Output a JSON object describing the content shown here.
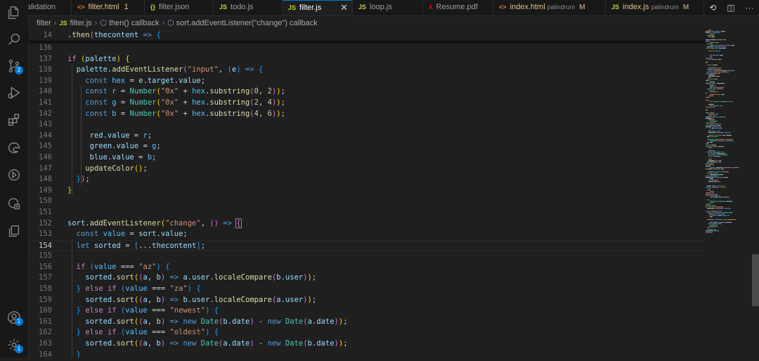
{
  "tabs": [
    {
      "label": "alidation",
      "icon": "",
      "desc": "",
      "flag": ""
    },
    {
      "label": "filter.html",
      "icon": "<>",
      "iconcls": "ic-html",
      "desc": "",
      "flag": "1",
      "flagcls": "err",
      "mod": true
    },
    {
      "label": "filter.json",
      "icon": "{}",
      "iconcls": "ic-json",
      "desc": "",
      "flag": ""
    },
    {
      "label": "todo.js",
      "icon": "JS",
      "iconcls": "ic-js",
      "desc": "",
      "flag": ""
    },
    {
      "label": "filter.js",
      "icon": "JS",
      "iconcls": "ic-js",
      "desc": "",
      "flag": "",
      "active": true
    },
    {
      "label": "loop.js",
      "icon": "JS",
      "iconcls": "ic-js",
      "desc": "",
      "flag": ""
    },
    {
      "label": "Resume.pdf",
      "icon": "⅄",
      "iconcls": "ic-pdf",
      "desc": "",
      "flag": ""
    },
    {
      "label": "index.html",
      "icon": "<>",
      "iconcls": "ic-html",
      "desc": "palindrum",
      "flag": "M",
      "mod": true
    },
    {
      "label": "index.js",
      "icon": "JS",
      "iconcls": "ic-js",
      "desc": "palindrum",
      "flag": "M",
      "mod": true
    }
  ],
  "tab_actions": {
    "history": "⟲",
    "split": "◫",
    "more": "···"
  },
  "breadcrumb": {
    "folder": "filter",
    "file_icon": "JS",
    "file": "filter.js",
    "scope1": "then() callback",
    "scope2": "sort.addEventListener(\"change\") callback"
  },
  "badges": {
    "source_control": "2",
    "accounts": "1",
    "manage": "1"
  },
  "activity_icons": [
    "explorer-icon",
    "search-icon",
    "source-control-icon",
    "run-debug-icon",
    "extensions-icon",
    "edge-icon",
    "github-actions-icon",
    "remote-explorer-icon",
    "copy-icon",
    "accounts-icon",
    "settings-gear-icon"
  ],
  "sticky_line": {
    "num": "14",
    "html": "  .<span class=\"fn\">then</span><span class=\"p2\">(</span><span class=\"var\">thecontent</span> <span class=\"kw\">=&gt;</span> <span class=\"p3\">{</span>"
  },
  "current_line": "154",
  "lines": [
    {
      "n": "136",
      "c": ""
    },
    {
      "n": "137",
      "c": "<span class=\"ctl\">if</span> <span class=\"p1\">(</span><span class=\"var\">palette</span><span class=\"p1\">)</span> <span class=\"p1\">{</span>"
    },
    {
      "n": "138",
      "c": "  <span class=\"var\">palette</span>.<span class=\"fn\">addEventListener</span><span class=\"p2\">(</span><span class=\"str\">\"input\"</span>, <span class=\"p3\">(</span><span class=\"var\">e</span><span class=\"p3\">)</span> <span class=\"kw\">=&gt;</span> <span class=\"p3\">{</span>"
    },
    {
      "n": "139",
      "c": "    <span class=\"kw\">const</span> <span class=\"cst\">hex</span> <span class=\"op\">=</span> <span class=\"var\">e</span>.<span class=\"var\">target</span>.<span class=\"var\">value</span>;"
    },
    {
      "n": "140",
      "c": "    <span class=\"kw\">const</span> <span class=\"cst\">r</span> <span class=\"op\">=</span> <span class=\"cls\">Number</span><span class=\"p1\">(</span><span class=\"str\">\"0x\"</span> <span class=\"op\">+</span> <span class=\"cst\">hex</span>.<span class=\"fn\">substring</span><span class=\"p2\">(</span><span class=\"num\">0</span>, <span class=\"num\">2</span><span class=\"p2\">)</span><span class=\"p1\">)</span>;"
    },
    {
      "n": "141",
      "c": "    <span class=\"kw\">const</span> <span class=\"cst\">g</span> <span class=\"op\">=</span> <span class=\"cls\">Number</span><span class=\"p1\">(</span><span class=\"str\">\"0x\"</span> <span class=\"op\">+</span> <span class=\"cst\">hex</span>.<span class=\"fn\">substring</span><span class=\"p2\">(</span><span class=\"num\">2</span>, <span class=\"num\">4</span><span class=\"p2\">)</span><span class=\"p1\">)</span>;"
    },
    {
      "n": "142",
      "c": "    <span class=\"kw\">const</span> <span class=\"cst\">b</span> <span class=\"op\">=</span> <span class=\"cls\">Number</span><span class=\"p1\">(</span><span class=\"str\">\"0x\"</span> <span class=\"op\">+</span> <span class=\"cst\">hex</span>.<span class=\"fn\">substring</span><span class=\"p2\">(</span><span class=\"num\">4</span>, <span class=\"num\">6</span><span class=\"p2\">)</span><span class=\"p1\">)</span>;"
    },
    {
      "n": "143",
      "c": ""
    },
    {
      "n": "144",
      "c": "     <span class=\"var\">red</span>.<span class=\"var\">value</span> <span class=\"op\">=</span> <span class=\"cst\">r</span>;"
    },
    {
      "n": "145",
      "c": "     <span class=\"var\">green</span>.<span class=\"var\">value</span> <span class=\"op\">=</span> <span class=\"cst\">g</span>;"
    },
    {
      "n": "146",
      "c": "     <span class=\"var\">blue</span>.<span class=\"var\">value</span> <span class=\"op\">=</span> <span class=\"cst\">b</span>;"
    },
    {
      "n": "147",
      "c": "    <span class=\"fn\">updateColor</span><span class=\"p1\">()</span>;"
    },
    {
      "n": "148",
      "c": "  <span class=\"p3\">}</span><span class=\"p2\">)</span>;"
    },
    {
      "n": "149",
      "c": "<span class=\"p1\">}</span>"
    },
    {
      "n": "150",
      "c": ""
    },
    {
      "n": "151",
      "c": ""
    },
    {
      "n": "152",
      "c": "<span class=\"var\">sort</span>.<span class=\"fn\">addEventListener</span><span class=\"p1\">(</span><span class=\"str\">\"change\"</span>, <span class=\"p2\">()</span> <span class=\"kw\">=&gt;</span> <span class=\"p2\" style=\"outline:1px solid #888\">{</span>"
    },
    {
      "n": "153",
      "c": "  <span class=\"kw\">const</span> <span class=\"cst\">value</span> <span class=\"op\">=</span> <span class=\"var\">sort</span>.<span class=\"var\">value</span>;"
    },
    {
      "n": "154",
      "c": "  <span class=\"kw\">let</span> <span class=\"var\">sorted</span> <span class=\"op\">=</span> <span class=\"p3\">[</span><span class=\"op\">...</span><span class=\"var\">thecontent</span><span class=\"p3\">]</span>;"
    },
    {
      "n": "155",
      "c": ""
    },
    {
      "n": "156",
      "c": "  <span class=\"ctl\">if</span> <span class=\"p3\">(</span><span class=\"cst\">value</span> <span class=\"op\">===</span> <span class=\"str\">\"az\"</span><span class=\"p3\">)</span> <span class=\"p3\">{</span>"
    },
    {
      "n": "157",
      "c": "    <span class=\"var\">sorted</span>.<span class=\"fn\">sort</span><span class=\"p1\">(</span><span class=\"p2\">(</span><span class=\"var\">a</span>, <span class=\"var\">b</span><span class=\"p2\">)</span> <span class=\"kw\">=&gt;</span> <span class=\"var\">a</span>.<span class=\"var\">user</span>.<span class=\"fn\">localeCompare</span><span class=\"p2\">(</span><span class=\"var\">b</span>.<span class=\"var\">user</span><span class=\"p2\">)</span><span class=\"p1\">)</span>;"
    },
    {
      "n": "158",
      "c": "  <span class=\"p3\">}</span> <span class=\"ctl\">else</span> <span class=\"ctl\">if</span> <span class=\"p3\">(</span><span class=\"cst\">value</span> <span class=\"op\">===</span> <span class=\"str\">\"za\"</span><span class=\"p3\">)</span> <span class=\"p3\">{</span>"
    },
    {
      "n": "159",
      "c": "    <span class=\"var\">sorted</span>.<span class=\"fn\">sort</span><span class=\"p1\">(</span><span class=\"p2\">(</span><span class=\"var\">a</span>, <span class=\"var\">b</span><span class=\"p2\">)</span> <span class=\"kw\">=&gt;</span> <span class=\"var\">b</span>.<span class=\"var\">user</span>.<span class=\"fn\">localeCompare</span><span class=\"p2\">(</span><span class=\"var\">a</span>.<span class=\"var\">user</span><span class=\"p2\">)</span><span class=\"p1\">)</span>;"
    },
    {
      "n": "160",
      "c": "  <span class=\"p3\">}</span> <span class=\"ctl\">else</span> <span class=\"ctl\">if</span> <span class=\"p3\">(</span><span class=\"cst\">value</span> <span class=\"op\">===</span> <span class=\"str\">\"newest\"</span><span class=\"p3\">)</span> <span class=\"p3\">{</span>"
    },
    {
      "n": "161",
      "c": "    <span class=\"var\">sorted</span>.<span class=\"fn\">sort</span><span class=\"p1\">(</span><span class=\"p2\">(</span><span class=\"var\">a</span>, <span class=\"var\">b</span><span class=\"p2\">)</span> <span class=\"kw\">=&gt;</span> <span class=\"kw\">new</span> <span class=\"cls\">Date</span><span class=\"p2\">(</span><span class=\"var\">b</span>.<span class=\"var\">date</span><span class=\"p2\">)</span> <span class=\"op\">-</span> <span class=\"kw\">new</span> <span class=\"cls\">Date</span><span class=\"p2\">(</span><span class=\"var\">a</span>.<span class=\"var\">date</span><span class=\"p2\">)</span><span class=\"p1\">)</span>;"
    },
    {
      "n": "162",
      "c": "  <span class=\"p3\">}</span> <span class=\"ctl\">else</span> <span class=\"ctl\">if</span> <span class=\"p3\">(</span><span class=\"cst\">value</span> <span class=\"op\">===</span> <span class=\"str\">\"oldest\"</span><span class=\"p3\">)</span> <span class=\"p3\">{</span>"
    },
    {
      "n": "163",
      "c": "    <span class=\"var\">sorted</span>.<span class=\"fn\">sort</span><span class=\"p1\">(</span><span class=\"p2\">(</span><span class=\"var\">a</span>, <span class=\"var\">b</span><span class=\"p2\">)</span> <span class=\"kw\">=&gt;</span> <span class=\"kw\">new</span> <span class=\"cls\">Date</span><span class=\"p2\">(</span><span class=\"var\">a</span>.<span class=\"var\">date</span><span class=\"p2\">)</span> <span class=\"op\">-</span> <span class=\"kw\">new</span> <span class=\"cls\">Date</span><span class=\"p2\">(</span><span class=\"var\">b</span>.<span class=\"var\">date</span><span class=\"p2\">)</span><span class=\"p1\">)</span>;"
    },
    {
      "n": "164",
      "c": "  <span class=\"p3\">}</span>"
    }
  ],
  "colors": {
    "editor_bg": "#1f1f1f",
    "activity_bg": "#181818",
    "accent": "#0078d4",
    "badge": "#0078d4",
    "modified": "#e2c08d",
    "error": "#f14c4c"
  }
}
